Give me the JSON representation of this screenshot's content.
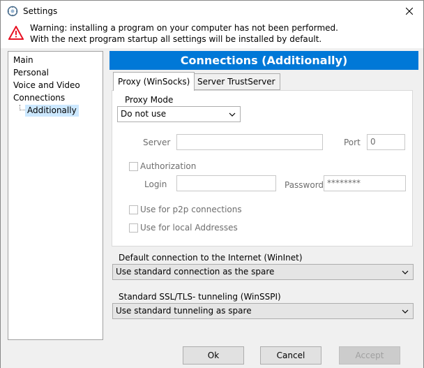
{
  "window": {
    "title": "Settings"
  },
  "warning": {
    "line1": "Warning: installing a program on your computer has not been performed.",
    "line2": "With the next program startup all settings will be installed by default."
  },
  "tree": {
    "items": [
      "Main",
      "Personal",
      "Voice and Video",
      "Connections"
    ],
    "sub_item": "Additionally"
  },
  "panel": {
    "header": "Connections (Additionally)",
    "tabs": [
      "Proxy (WinSocks)",
      "Server TrustServer"
    ],
    "proxy_mode_label": "Proxy Mode",
    "proxy_mode_value": "Do not use",
    "server_label": "Server",
    "server_value": "",
    "port_label": "Port",
    "port_value": "0",
    "authorization_label": "Authorization",
    "login_label": "Login",
    "login_value": "",
    "password_label": "Password",
    "password_value": "********",
    "p2p_label": "Use for p2p connections",
    "local_label": "Use for local Addresses"
  },
  "internet": {
    "label": "Default connection to the Internet (WinInet)",
    "value": "Use standard connection as the spare"
  },
  "ssl": {
    "label": "Standard SSL/TLS- tunneling (WinSSPI)",
    "value": "Use standard tunneling as spare"
  },
  "buttons": {
    "ok": "Ok",
    "cancel": "Cancel",
    "accept": "Accept"
  },
  "colors": {
    "accent": "#0078d7",
    "selection": "#cce8ff",
    "warning": "#e81123"
  }
}
